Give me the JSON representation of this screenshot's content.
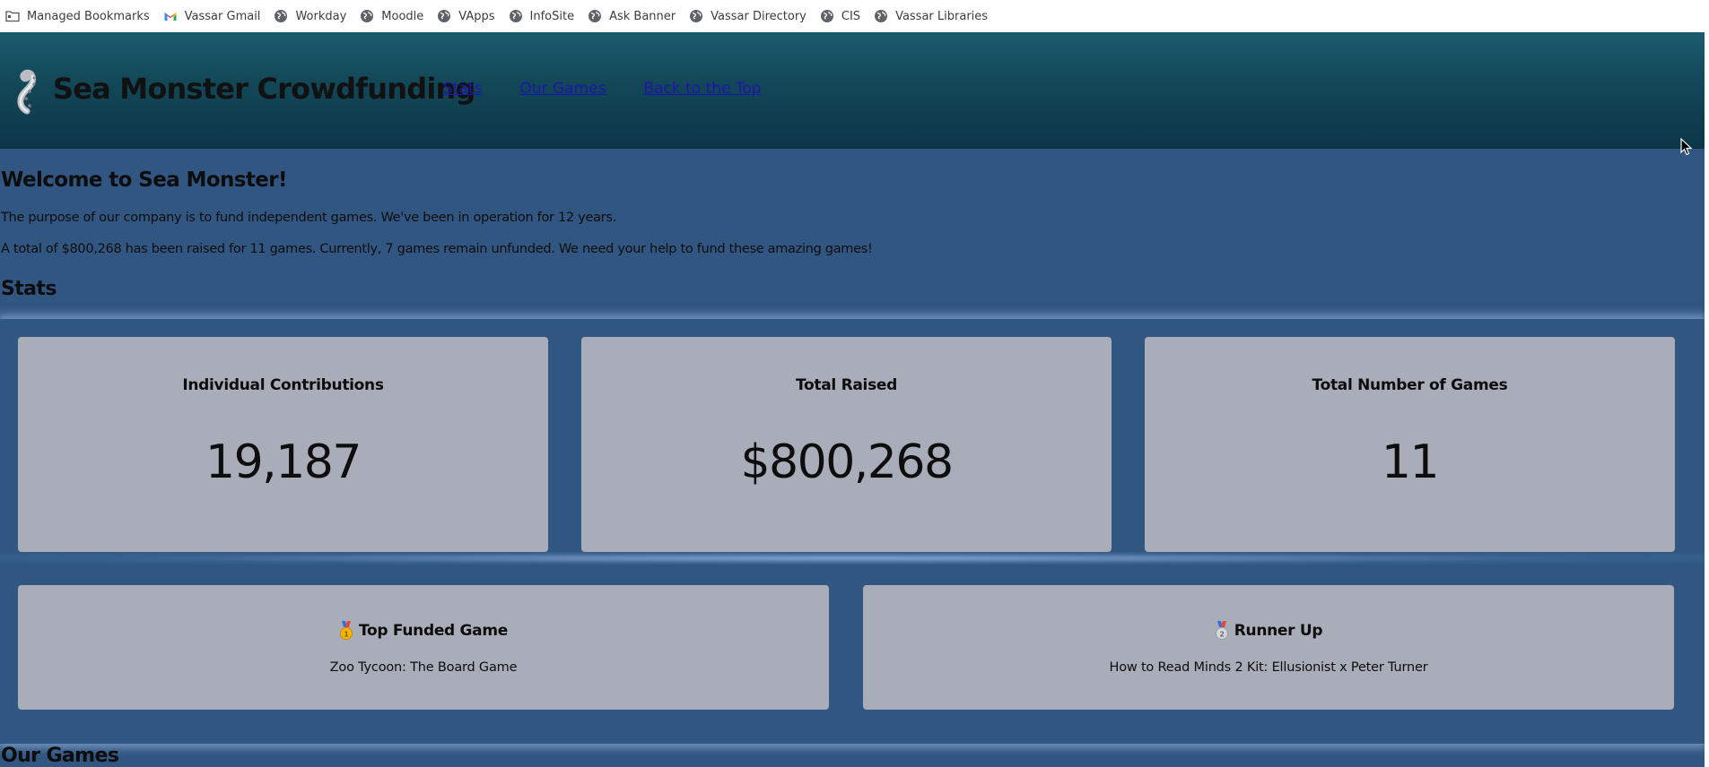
{
  "bookmarks": [
    {
      "label": "Managed Bookmarks",
      "icon": "folder-icon"
    },
    {
      "label": "Vassar Gmail",
      "icon": "gmail-icon"
    },
    {
      "label": "Workday",
      "icon": "globe-icon"
    },
    {
      "label": "Moodle",
      "icon": "globe-icon"
    },
    {
      "label": "VApps",
      "icon": "globe-icon"
    },
    {
      "label": "InfoSite",
      "icon": "globe-icon"
    },
    {
      "label": "Ask Banner",
      "icon": "globe-icon"
    },
    {
      "label": "Vassar Directory",
      "icon": "globe-icon"
    },
    {
      "label": "CIS",
      "icon": "globe-icon"
    },
    {
      "label": "Vassar Libraries",
      "icon": "globe-icon"
    }
  ],
  "header": {
    "brand": "Sea Monster Crowdfunding",
    "logo_icon": "tentacle-logo-icon",
    "nav": [
      "Stats",
      "Our Games",
      "Back to the Top"
    ]
  },
  "intro": {
    "welcome": "Welcome to Sea Monster!",
    "p1": "The purpose of our company is to fund independent games. We've been in operation for 12 years.",
    "p2": "A total of $800,268 has been raised for 11 games. Currently, 7 games remain unfunded. We need your help to fund these amazing games!"
  },
  "stats": {
    "heading": "Stats",
    "cards": [
      {
        "title": "Individual Contributions",
        "value": "19,187"
      },
      {
        "title": "Total Raised",
        "value": "$800,268"
      },
      {
        "title": "Total Number of Games",
        "value": "11"
      }
    ],
    "top_funded": {
      "title": "Top Funded Game",
      "name": "Zoo Tycoon: The Board Game",
      "icon": "gold-medal-icon"
    },
    "runner_up": {
      "title": "Runner Up",
      "name": "How to Read Minds 2 Kit: Ellusionist x Peter Turner",
      "icon": "silver-medal-icon"
    }
  },
  "games": {
    "heading": "Our Games"
  },
  "colors": {
    "page_bg": "#325682",
    "header_top": "#1b5b6e",
    "header_bottom": "#0c3647",
    "card_bg": "#a9adb9",
    "nav_link": "#1e14b0"
  }
}
